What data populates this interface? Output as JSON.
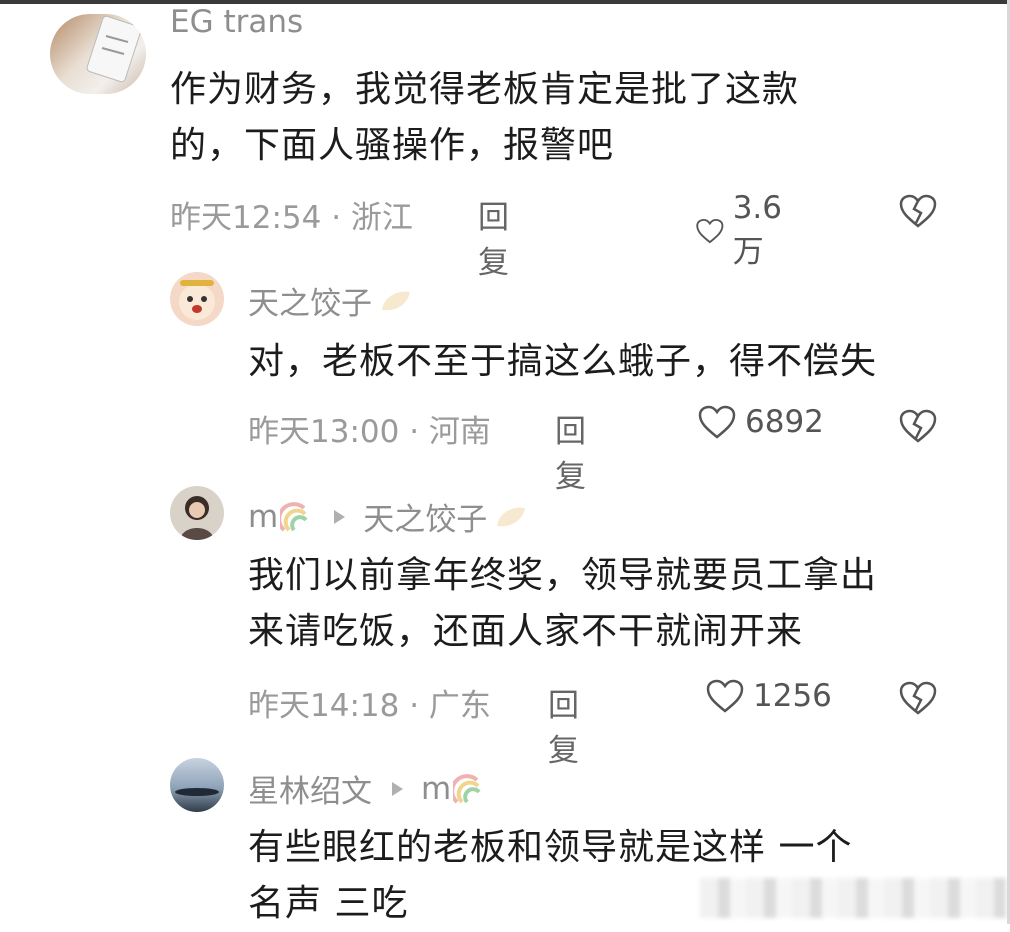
{
  "comments": [
    {
      "username": "EG trans",
      "text_lines": [
        "作为财务，我觉得老板肯定是批了这款",
        "的，下面人骚操作，报警吧"
      ],
      "time": "昨天12:54",
      "location": "浙江",
      "reply_label": "回复",
      "likes": "3.6万"
    },
    {
      "username": "天之饺子",
      "text_lines": [
        "对，老板不至于搞这么蛾子，得不偿失"
      ],
      "time": "昨天13:00",
      "location": "河南",
      "reply_label": "回复",
      "likes": "6892"
    },
    {
      "username": "m",
      "reply_to": "天之饺子",
      "text_lines": [
        "我们以前拿年终奖，领导就要员工拿出",
        "来请吃饭，还面人家不干就闹开来"
      ],
      "time": "昨天14:18",
      "location": "广东",
      "reply_label": "回复",
      "likes": "1256"
    },
    {
      "username": "星林绍文",
      "reply_to": "m",
      "text_lines": [
        "有些眼红的老板和领导就是这样 一个",
        "名声 三吃"
      ]
    }
  ],
  "colors": {
    "text": "#1c1c1c",
    "meta": "#9a9a9a",
    "name": "#8e8e8e"
  },
  "icons": [
    "heart-outline-icon",
    "broken-heart-icon",
    "reply-arrow-icon",
    "rainbow-badge-icon",
    "leaf-badge-icon"
  ]
}
